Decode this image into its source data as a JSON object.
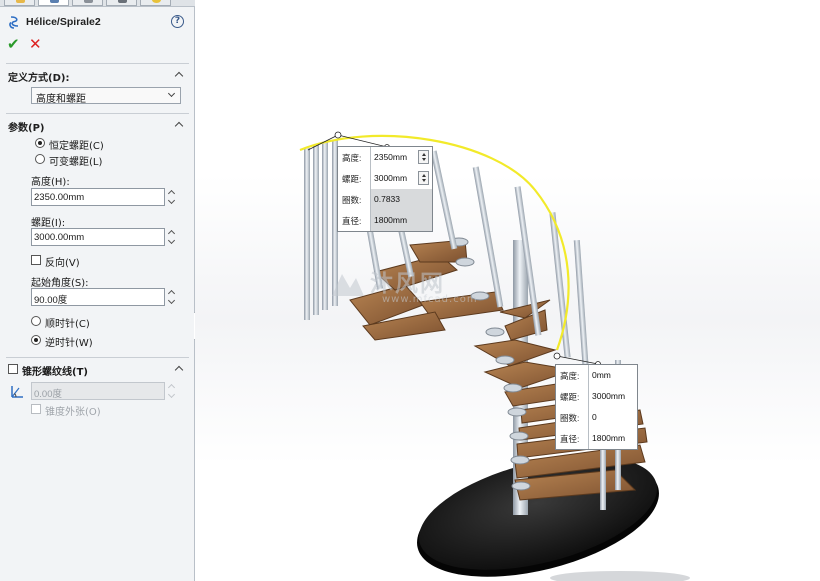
{
  "feature": {
    "title": "Hélice/Spirale2",
    "help_glyph": "?"
  },
  "actions": {
    "ok_glyph": "✔",
    "cancel_glyph": "✕"
  },
  "define_by": {
    "header": "定义方式(D):",
    "selected": "高度和螺距"
  },
  "parameters": {
    "header": "参数(P)",
    "constant_pitch": "恒定螺距(C)",
    "variable_pitch": "可变螺距(L)",
    "height_label": "高度(H):",
    "height_value": "2350.00mm",
    "pitch_label": "螺距(I):",
    "pitch_value": "3000.00mm",
    "reverse_label": "反向(V)",
    "start_angle_label": "起始角度(S):",
    "start_angle_value": "90.00度",
    "clockwise_label": "顺时针(C)",
    "counterclockwise_label": "逆时针(W)"
  },
  "taper": {
    "header": "锥形螺纹线(T)",
    "angle_value": "0.00度",
    "taper_outward_label": "锥度外张(O)"
  },
  "callout_top": {
    "rows": [
      {
        "label": "高度:",
        "value": "2350mm"
      },
      {
        "label": "螺距:",
        "value": "3000mm"
      },
      {
        "label": "圈数:",
        "value": "0.7833"
      },
      {
        "label": "直径:",
        "value": "1800mm"
      }
    ]
  },
  "callout_bottom": {
    "rows": [
      {
        "label": "高度:",
        "value": "0mm"
      },
      {
        "label": "螺距:",
        "value": "3000mm"
      },
      {
        "label": "圈数:",
        "value": "0"
      },
      {
        "label": "直径:",
        "value": "1800mm"
      }
    ]
  },
  "watermark": {
    "text": "沐风网",
    "url": "www.mfcad.com"
  },
  "colors": {
    "helix_path": "#f2ea2a",
    "wood": "#9a6a3e",
    "base": "#1a1a1a",
    "rail": "#c4ccd6"
  }
}
